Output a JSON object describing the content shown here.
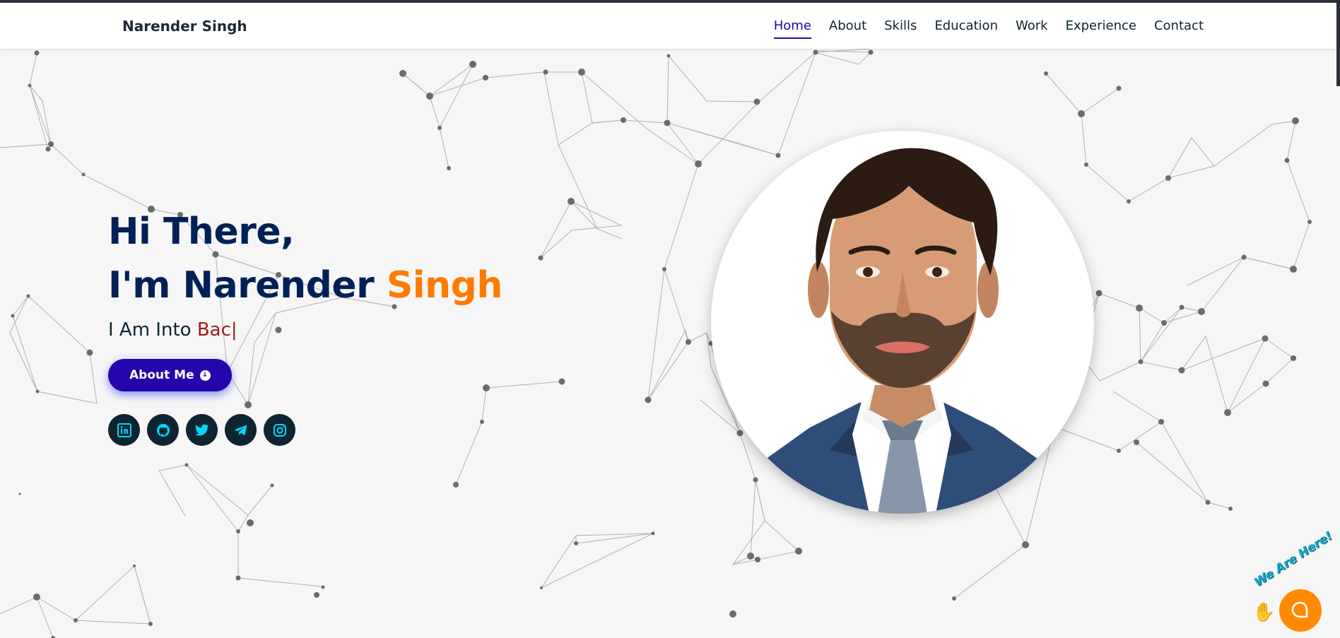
{
  "navbar": {
    "brand": "Narender Singh",
    "links": [
      "Home",
      "About",
      "Skills",
      "Education",
      "Work",
      "Experience",
      "Contact"
    ],
    "active_index": 0
  },
  "hero": {
    "line1": "Hi There,",
    "line2_prefix": "I'm Narender ",
    "line2_accent": "Singh",
    "typing_prefix": "I Am Into ",
    "typing_value": "Bac",
    "typing_cursor": "|",
    "about_button": "About Me"
  },
  "socials": [
    "linkedin-icon",
    "github-icon",
    "twitter-icon",
    "telegram-icon",
    "instagram-icon"
  ],
  "chat_widget": {
    "label": "We Are Here!"
  },
  "colors": {
    "primary": "#2506ad",
    "heading": "#002057",
    "accent": "#ff7a00",
    "typed": "#a11a1a",
    "social_bg": "#0e2431",
    "social_icon": "#00d8ff",
    "chat_orange": "#ff8a00"
  }
}
